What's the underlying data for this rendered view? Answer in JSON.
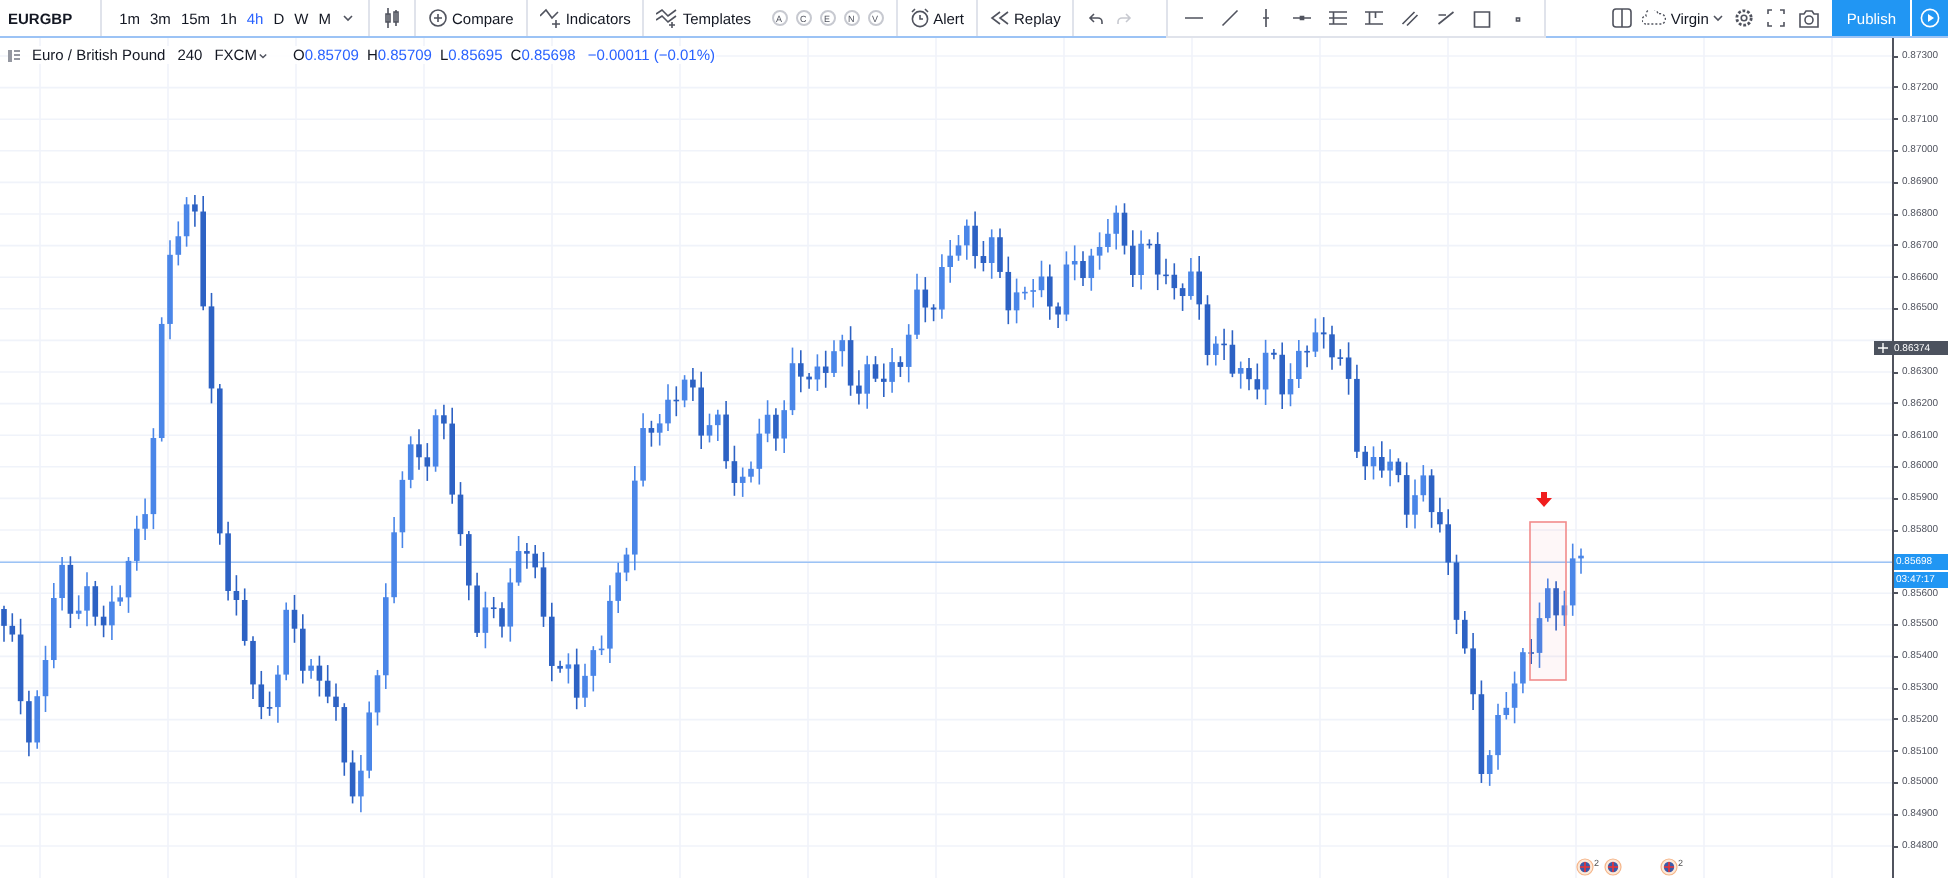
{
  "toolbar": {
    "symbol": "EURGBP",
    "intervals": [
      {
        "label": "1m",
        "selected": false
      },
      {
        "label": "3m",
        "selected": false
      },
      {
        "label": "15m",
        "selected": false
      },
      {
        "label": "1h",
        "selected": false
      },
      {
        "label": "4h",
        "selected": true
      },
      {
        "label": "D",
        "selected": false
      },
      {
        "label": "W",
        "selected": false
      },
      {
        "label": "M",
        "selected": false
      }
    ],
    "compare": "Compare",
    "indicators": "Indicators",
    "templates": "Templates",
    "template_letters": [
      "A",
      "C",
      "E",
      "N",
      "V"
    ],
    "alert": "Alert",
    "replay": "Replay",
    "layout": "Virgin",
    "publish": "Publish"
  },
  "legend": {
    "name": "Euro / British Pound",
    "interval": "240",
    "source": "FXCM",
    "ohlc": [
      {
        "key": "O",
        "value": "0.85709"
      },
      {
        "key": "H",
        "value": "0.85709"
      },
      {
        "key": "L",
        "value": "0.85695"
      },
      {
        "key": "C",
        "value": "0.85698"
      }
    ],
    "change": "−0.00011 (−0.01%)"
  },
  "price_axis": {
    "ticks": [
      "0.87300",
      "0.87200",
      "0.87100",
      "0.87000",
      "0.86900",
      "0.86800",
      "0.86700",
      "0.86600",
      "0.86500",
      "0.86300",
      "0.86200",
      "0.86100",
      "0.86000",
      "0.85900",
      "0.85800",
      "0.85600",
      "0.85500",
      "0.85400",
      "0.85300",
      "0.85200",
      "0.85100",
      "0.85000",
      "0.84900",
      "0.84800"
    ],
    "crosshair_price": "0.86374",
    "last_price": "0.85698",
    "countdown": "03:47:17"
  },
  "events": [
    {
      "kind": "economic",
      "count": "2"
    },
    {
      "kind": "economic"
    },
    {
      "kind": "economic",
      "count": "2"
    }
  ]
}
